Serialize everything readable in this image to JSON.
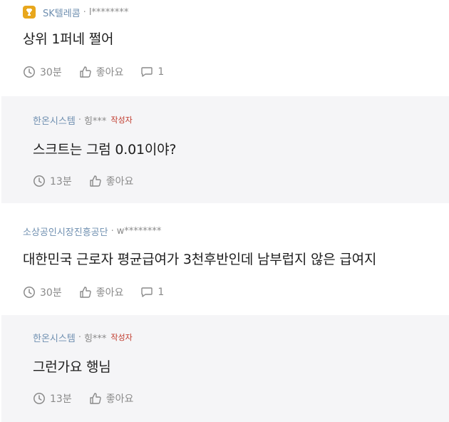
{
  "comments": [
    {
      "company": "SK텔레콤",
      "author": "l********",
      "text": "상위 1퍼네 쩔어",
      "time": "30분",
      "like_label": "좋아요",
      "reply_count": "1"
    },
    {
      "company": "한온시스템",
      "author": "힝***",
      "op_tag": "작성자",
      "text": "스크트는 그럼 0.01이야?",
      "time": "13분",
      "like_label": "좋아요"
    },
    {
      "company": "소상공인시장진흥공단",
      "author": "w********",
      "text": "대한민국 근로자 평균급여가 3천후반인데 남부럽지 않은 급여지",
      "time": "30분",
      "like_label": "좋아요",
      "reply_count": "1"
    },
    {
      "company": "한온시스템",
      "author": "힝***",
      "op_tag": "작성자",
      "text": "그런가요 행님",
      "time": "13분",
      "like_label": "좋아요"
    }
  ],
  "separator": "·",
  "colors": {
    "company": "#6f8fb0",
    "op_tag": "#c0392b",
    "reply_bg": "#f5f5f7",
    "badge": "#e8a71d"
  }
}
